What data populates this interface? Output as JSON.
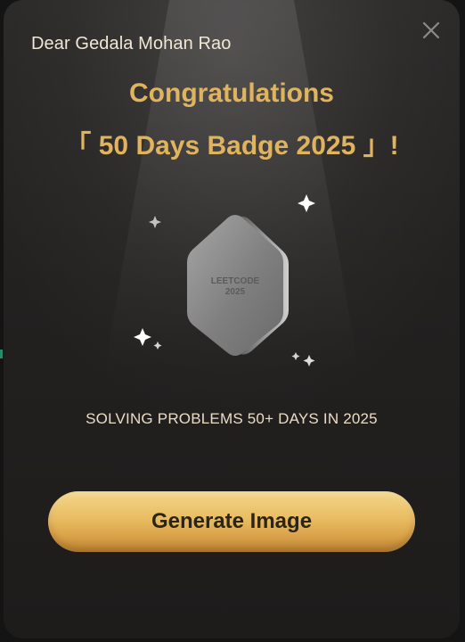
{
  "modal": {
    "greeting": "Dear Gedala Mohan Rao",
    "title_line1": "Congratulations",
    "title_line2": "「 50 Days Badge 2025 」!",
    "badge": {
      "label_top": "LEETCODE",
      "label_bottom": "2025"
    },
    "subtitle": "SOLVING PROBLEMS 50+ DAYS IN 2025",
    "generate_button_label": "Generate Image",
    "close_icon": "close-icon"
  },
  "colors": {
    "title_gold": "#e0b35f",
    "button_gold": "#e9bd62",
    "background": "#232120",
    "badge_silver": "#8a8a8a"
  }
}
